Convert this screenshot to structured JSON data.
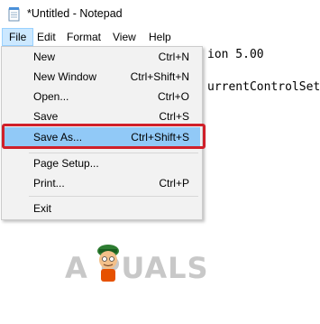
{
  "window": {
    "title": "*Untitled - Notepad"
  },
  "menubar": {
    "items": [
      {
        "label": "File"
      },
      {
        "label": "Edit"
      },
      {
        "label": "Format"
      },
      {
        "label": "View"
      },
      {
        "label": "Help"
      }
    ]
  },
  "editor": {
    "lines": [
      "ion 5.00",
      "urrentControlSet"
    ]
  },
  "file_menu": {
    "items": [
      {
        "label": "New",
        "shortcut": "Ctrl+N"
      },
      {
        "label": "New Window",
        "shortcut": "Ctrl+Shift+N"
      },
      {
        "label": "Open...",
        "shortcut": "Ctrl+O"
      },
      {
        "label": "Save",
        "shortcut": "Ctrl+S"
      },
      {
        "label": "Save As...",
        "shortcut": "Ctrl+Shift+S"
      },
      {
        "label": "Page Setup...",
        "shortcut": ""
      },
      {
        "label": "Print...",
        "shortcut": "Ctrl+P"
      },
      {
        "label": "Exit",
        "shortcut": ""
      }
    ]
  },
  "watermark": {
    "text": "A PUALS"
  },
  "colors": {
    "highlight": "#91c9f7",
    "annotation_box": "#d0202a",
    "menu_active": "#cce8ff"
  }
}
